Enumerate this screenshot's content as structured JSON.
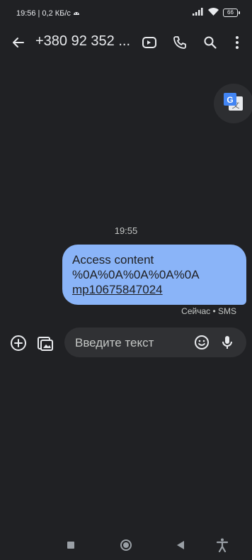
{
  "status_bar": {
    "time": "19:56",
    "network_speed": "0,2 КБ/с",
    "battery": "66"
  },
  "header": {
    "title": "+380 92 352 ...",
    "back_icon": "arrow-left-icon",
    "actions": [
      "video-call-icon",
      "phone-icon",
      "search-icon",
      "more-vert-icon"
    ]
  },
  "translate_button": {
    "icon": "google-translate-icon"
  },
  "conversation": {
    "timestamp": "19:55",
    "messages": [
      {
        "line1": "Access content",
        "line2": "%0A%0A%0A%0A%0A",
        "link": "mp10675847024",
        "meta": "Сейчас • SMS",
        "color": "#8ab4f8"
      }
    ]
  },
  "composer": {
    "placeholder": "Введите текст",
    "icons": [
      "add-circle-icon",
      "gallery-icon",
      "emoji-icon",
      "mic-icon"
    ]
  },
  "nav_bar": {
    "icons": [
      "recents-square-icon",
      "home-circle-icon",
      "back-triangle-icon",
      "accessibility-icon"
    ]
  },
  "colors": {
    "background": "#202124",
    "bubble": "#8ab4f8",
    "input_bg": "#303134",
    "text": "#e8eaed"
  }
}
